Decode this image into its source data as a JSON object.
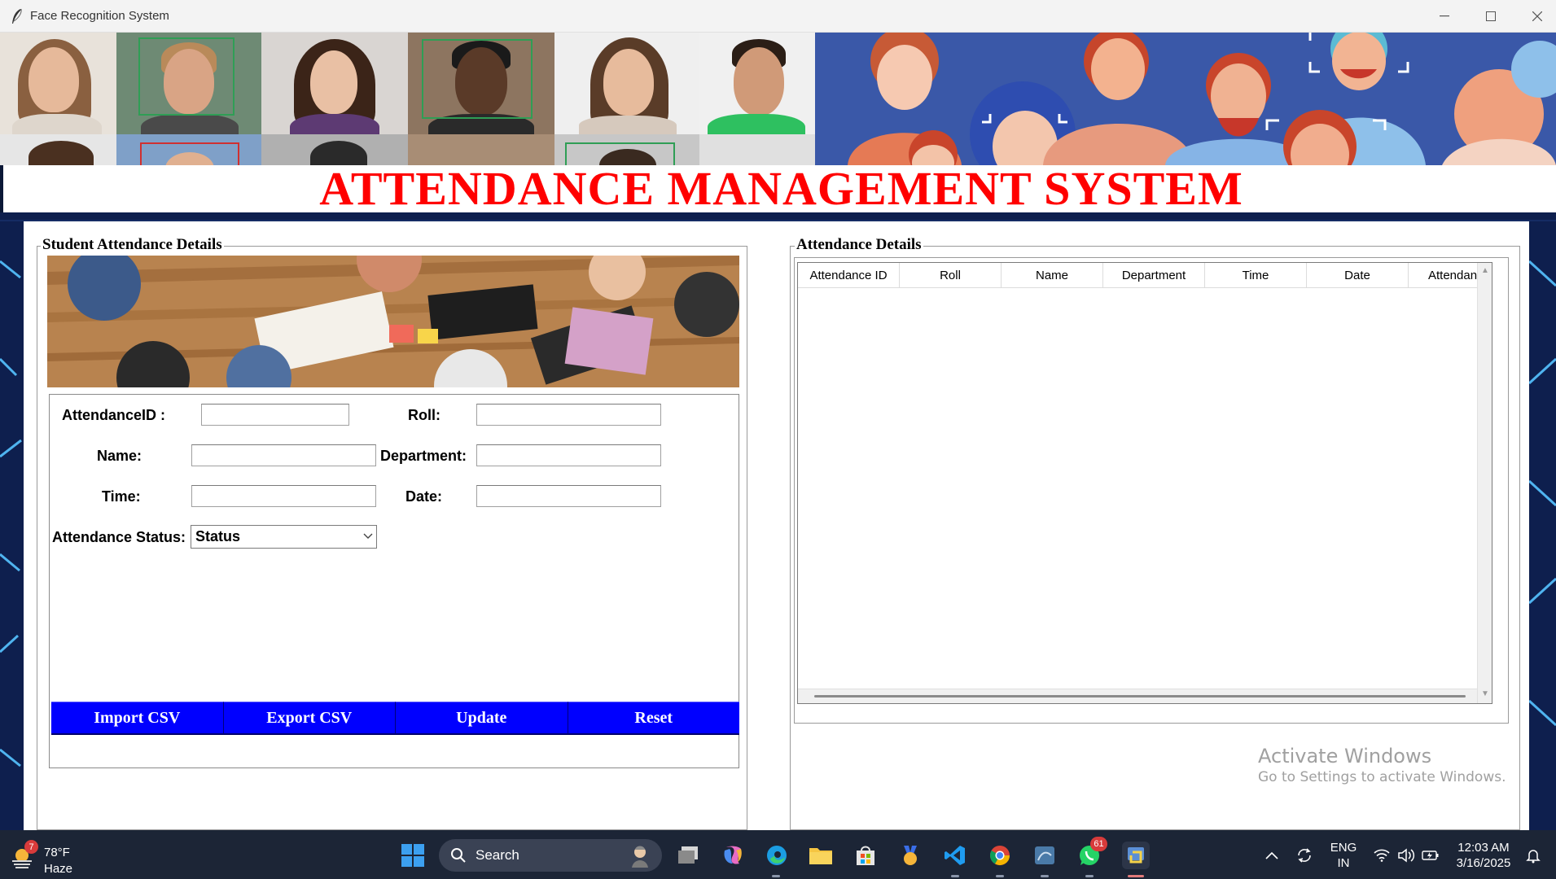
{
  "window": {
    "title": "Face Recognition System",
    "controls": [
      "—",
      "☐",
      "✕"
    ]
  },
  "page_title": "ATTENDANCE MANAGEMENT SYSTEM",
  "left_panel": {
    "title": "Student Attendance Details",
    "fields": {
      "attendance_id": {
        "label": "AttendanceID :",
        "value": ""
      },
      "roll": {
        "label": "Roll:",
        "value": ""
      },
      "name": {
        "label": "Name:",
        "value": ""
      },
      "department": {
        "label": "Department:",
        "value": ""
      },
      "time": {
        "label": "Time:",
        "value": ""
      },
      "date": {
        "label": "Date:",
        "value": ""
      },
      "status": {
        "label": "Attendance Status:",
        "value": "Status"
      }
    },
    "buttons": {
      "import": "Import CSV",
      "export": "Export CSV",
      "update": "Update",
      "reset": "Reset"
    }
  },
  "right_panel": {
    "title": "Attendance Details",
    "columns": [
      "Attendance ID",
      "Roll",
      "Name",
      "Department",
      "Time",
      "Date",
      "Attendance"
    ],
    "rows": []
  },
  "watermark": {
    "line1": "Activate Windows",
    "line2": "Go to Settings to activate Windows."
  },
  "taskbar": {
    "weather": {
      "temp": "78°F",
      "condition": "Haze",
      "badge": "7"
    },
    "search_placeholder": "Search",
    "whatsapp_badge": "61",
    "language": {
      "line1": "ENG",
      "line2": "IN"
    },
    "clock": {
      "time": "12:03 AM",
      "date": "3/16/2025"
    }
  },
  "colors": {
    "title_red": "#ff0000",
    "button_blue": "#0000ff",
    "background_navy": "#0e1f4e",
    "taskbar": "#1c2536"
  }
}
